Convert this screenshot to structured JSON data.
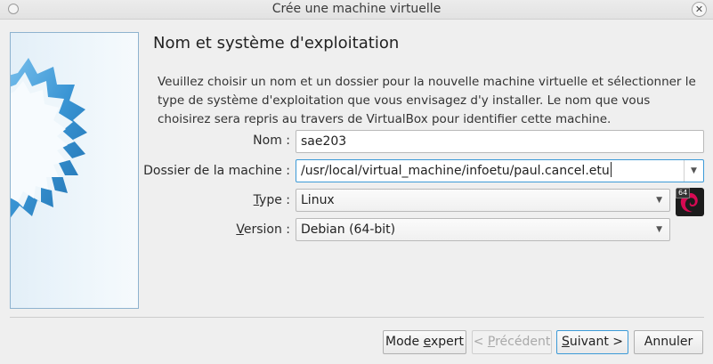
{
  "window": {
    "title": "Crée une machine virtuelle",
    "close_glyph": "✕"
  },
  "page": {
    "heading": "Nom et système d'exploitation",
    "description": "Veuillez choisir un nom et un dossier pour la nouvelle machine virtuelle et sélectionner le type de système d'exploitation que vous envisagez d'y installer. Le nom que vous choisirez sera repris au travers de VirtualBox pour identifier cette machine."
  },
  "form": {
    "name_label": "Nom :",
    "name_value": "sae203",
    "folder_label": "Dossier de la machine :",
    "folder_value": "/usr/local/virtual_machine/infoetu/paul.cancel.etu",
    "type_label_mnemonic": "T",
    "type_label_rest": "ype :",
    "type_value": "Linux",
    "version_label_mnemonic": "V",
    "version_label_rest": "ersion :",
    "version_value": "Debian (64-bit)",
    "os_icon_badge": "64",
    "os_icon": "debian-swirl-icon"
  },
  "buttons": {
    "expert_pre": "Mode ",
    "expert_mnemonic": "e",
    "expert_post": "xpert",
    "previous_pre": "< ",
    "previous_mnemonic": "P",
    "previous_post": "récédent",
    "next_mnemonic": "S",
    "next_post": "uivant >",
    "cancel": "Annuler"
  },
  "colors": {
    "focus_border": "#3c9ad7",
    "side_art_star": "#4aa3dc"
  }
}
